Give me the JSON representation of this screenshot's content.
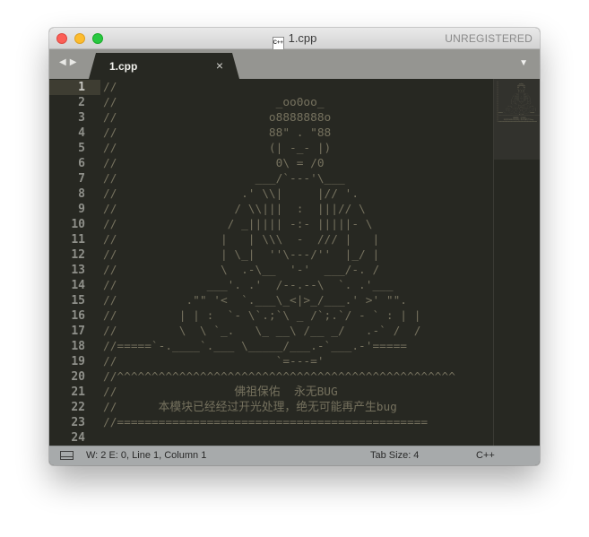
{
  "window": {
    "title": "1.cpp",
    "file_icon_label": "C++",
    "license_label": "UNREGISTERED"
  },
  "tabs": {
    "nav_back_icon": "chevron-left",
    "nav_forward_icon": "chevron-right",
    "active_tab": {
      "label": "1.cpp",
      "close_glyph": "×"
    },
    "menu_icon": "triangle-down"
  },
  "editor": {
    "current_line": 1,
    "line_numbers": [
      "1",
      "2",
      "3",
      "4",
      "5",
      "6",
      "7",
      "8",
      "9",
      "10",
      "11",
      "12",
      "13",
      "14",
      "15",
      "16",
      "17",
      "18",
      "19",
      "20",
      "21",
      "22",
      "23",
      "24"
    ],
    "lines": [
      "//",
      "//                       _oo0oo_",
      "//                      o8888888o",
      "//                      88\" . \"88",
      "//                      (| -_- |)",
      "//                       0\\ = /0",
      "//                    ___/`---'\\___",
      "//                  .' \\\\|     |// '.",
      "//                 / \\\\|||  :  |||// \\",
      "//                / _||||| -:- |||||- \\",
      "//               |   | \\\\\\  -  /// |   |",
      "//               | \\_|  ''\\---/''  |_/ |",
      "//               \\  .-\\__  '-'  ___/-. /",
      "//             ___'. .'  /--.--\\  `. .'___",
      "//          .\"\" '<  `.___\\_<|>_/___.' >' \"\".",
      "//         | | :  `- \\`.;`\\ _ /`;.`/ - ` : | |",
      "//         \\  \\ `_.   \\_ __\\ /__ _/   .-` /  /",
      "//=====`-.____`.___ \\_____/___.-`___.-'=====",
      "//                       `=---='",
      "//^^^^^^^^^^^^^^^^^^^^^^^^^^^^^^^^^^^^^^^^^^^^^^^^^",
      "//                 佛祖保佑  永无BUG",
      "//      本模块已经经过开光处理，绝无可能再产生bug",
      "//=============================================",
      ""
    ]
  },
  "status": {
    "panel_icon": "panel-toggle",
    "position_text": "W: 2 E: 0, Line 1, Column 1",
    "tab_size": "Tab Size: 4",
    "syntax": "C++"
  },
  "colors": {
    "editor_bg": "#272822",
    "comment": "#75715e",
    "gutter_text": "#8f908a",
    "tab_bar": "#959591",
    "status_bar": "#a7aaab"
  }
}
